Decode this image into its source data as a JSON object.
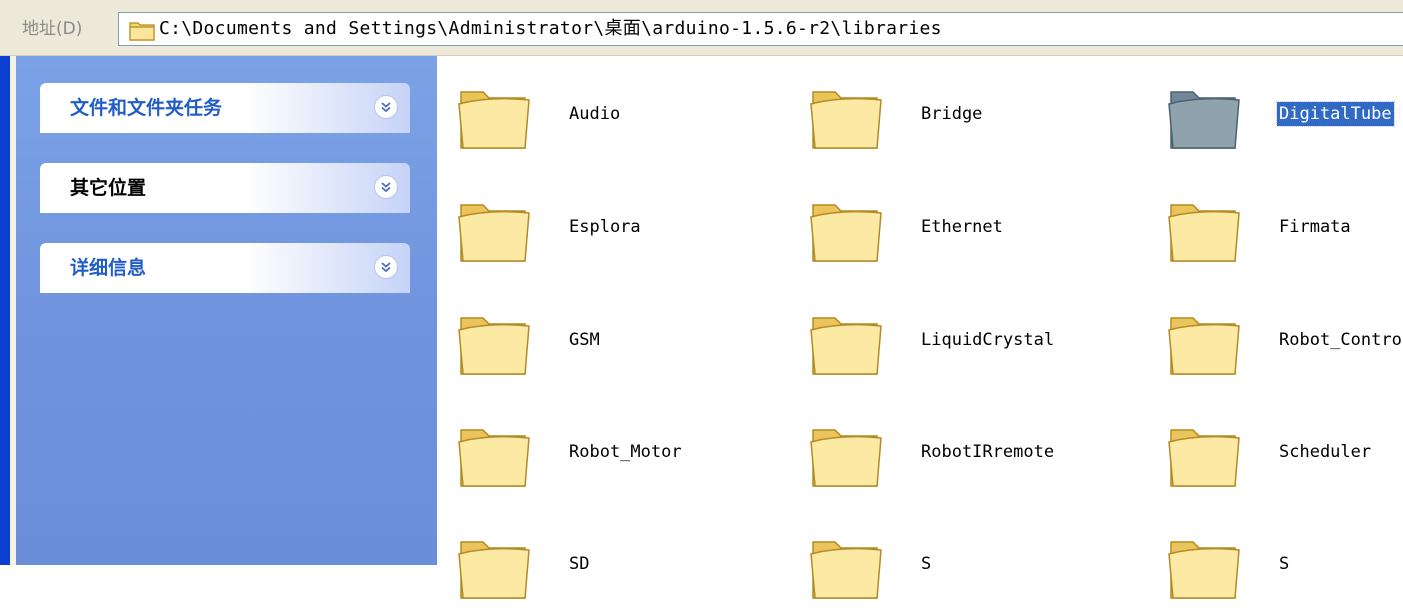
{
  "address_bar": {
    "label": "地址(D)",
    "path": "C:\\Documents and Settings\\Administrator\\桌面\\arduino-1.5.6-r2\\libraries"
  },
  "task_pane": {
    "sections": [
      {
        "title": "文件和文件夹任务",
        "icon": "chevron-double-down-icon"
      },
      {
        "title": "其它位置",
        "icon": "chevron-double-down-icon"
      },
      {
        "title": "详细信息",
        "icon": "chevron-double-down-icon"
      }
    ]
  },
  "folders": [
    {
      "name": "Audio",
      "selected": false
    },
    {
      "name": "Bridge",
      "selected": false
    },
    {
      "name": "DigitalTube",
      "selected": true
    },
    {
      "name": "Esplora",
      "selected": false
    },
    {
      "name": "Ethernet",
      "selected": false
    },
    {
      "name": "Firmata",
      "selected": false
    },
    {
      "name": "GSM",
      "selected": false
    },
    {
      "name": "LiquidCrystal",
      "selected": false
    },
    {
      "name": "Robot_Contro",
      "selected": false
    },
    {
      "name": "Robot_Motor",
      "selected": false
    },
    {
      "name": "RobotIRremote",
      "selected": false
    },
    {
      "name": "Scheduler",
      "selected": false
    },
    {
      "name": "SD",
      "selected": false
    },
    {
      "name": "S",
      "selected": false
    },
    {
      "name": "S",
      "selected": false
    }
  ],
  "colors": {
    "accent": "#215dc6",
    "selection": "#316ac5",
    "task_pane_bg": "#7ba2e7",
    "folder_yellow": "#f7dc7a"
  }
}
